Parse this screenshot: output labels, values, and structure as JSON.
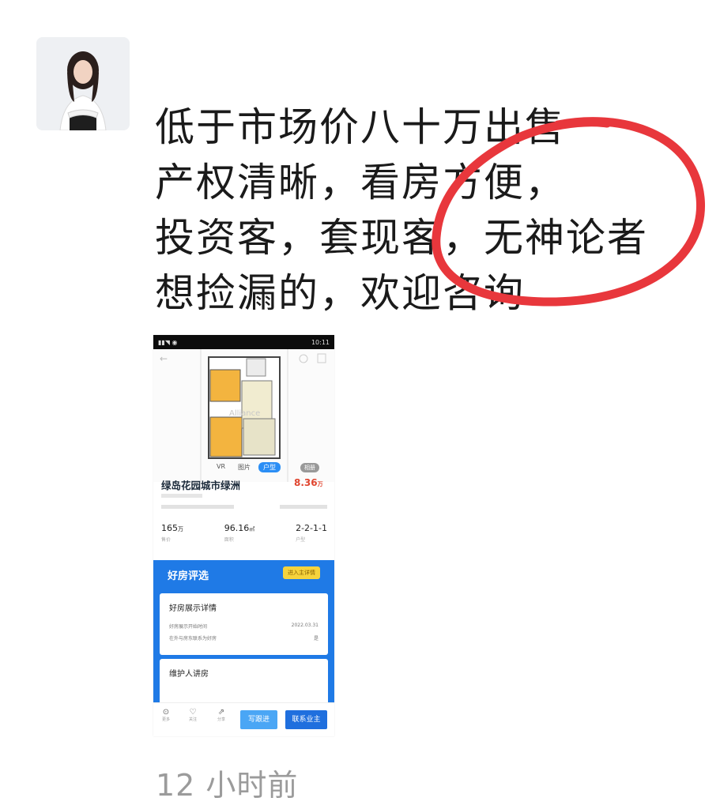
{
  "post": {
    "lines": [
      "低于市场价八十万出售",
      "产权清晰，看房方便，",
      "投资客，套现客，无神论者",
      "想捡漏的，欢迎咨询"
    ],
    "timestamp": "12 小时前",
    "highlight_color": "#e8373c"
  },
  "phone": {
    "status_time": "10:11",
    "floorplan_tabs": [
      "VR",
      "图片",
      "户型"
    ],
    "floorplan_active_tab": "户型",
    "floorplan_more": "相册",
    "watermark": "Alliance",
    "listing": {
      "title": "绿岛花园城市绿洲",
      "price": "8.36",
      "price_unit": "万",
      "stats": [
        {
          "value": "165",
          "unit": "万",
          "label": "售价"
        },
        {
          "value": "96.16",
          "unit": "㎡",
          "label": "面积"
        },
        {
          "value": "2-2-1-1",
          "unit": "",
          "label": "户型"
        }
      ]
    },
    "panel": {
      "title": "好房评选",
      "button": "进入主详情",
      "card1_title": "好房展示详情",
      "card1_rows": [
        {
          "label": "好房展示开始时间",
          "value": "2022.03.31"
        },
        {
          "label": "在外与房东联系为好房",
          "value": "是"
        }
      ],
      "card2_title": "维护人讲房"
    },
    "bottom": {
      "icons": [
        {
          "icon": "more-icon",
          "label": "更多"
        },
        {
          "icon": "heart-icon",
          "label": "关注"
        },
        {
          "icon": "share-icon",
          "label": "分享"
        }
      ],
      "btn_light": "写跟进",
      "btn_dark": "联系业主"
    }
  },
  "colors": {
    "accent_blue": "#1f7ae6",
    "price_red": "#e0452f"
  }
}
